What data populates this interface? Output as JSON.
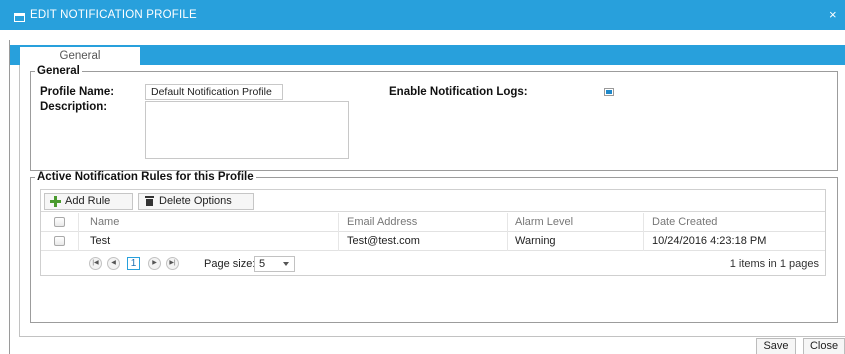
{
  "dialog": {
    "title": "EDIT NOTIFICATION PROFILE",
    "close_glyph": "×",
    "title_icon": "window-icon"
  },
  "tabs": [
    {
      "label": "General",
      "selected": true
    }
  ],
  "general": {
    "legend": "General",
    "profile_name_label": "Profile Name:",
    "profile_name_value": "Default Notification Profile",
    "description_label": "Description:",
    "description_value": "",
    "enable_logs_label": "Enable Notification Logs:",
    "enable_logs_checked": true
  },
  "rules": {
    "legend": "Active Notification Rules for this Profile",
    "toolbar": {
      "add_label": "Add Rule",
      "add_icon": "plus-icon",
      "delete_label": "Delete Options",
      "delete_icon": "trash-icon"
    },
    "columns": [
      "Name",
      "Email Address",
      "Alarm Level",
      "Date Created"
    ],
    "rows": [
      [
        "Test",
        "Test@test.com",
        "Warning",
        "10/24/2016 4:23:18 PM"
      ]
    ],
    "pager": {
      "current_page": "1",
      "page_size_label": "Page size:",
      "page_size_value": "5",
      "info": "1 items in 1 pages"
    }
  },
  "footer": {
    "save_label": "Save",
    "close_label": "Close"
  },
  "colors": {
    "accent": "#28a0dc",
    "checkbox_fill": "#1f88c9",
    "add_icon": "#4a9a2e"
  }
}
